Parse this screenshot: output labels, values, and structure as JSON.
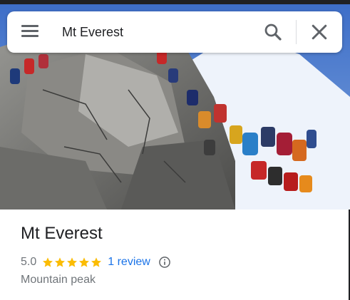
{
  "search": {
    "value": "Mt Everest",
    "placeholder": ""
  },
  "icons": {
    "menu": "menu-icon",
    "search": "search-icon",
    "close": "close-icon",
    "star": "star-icon",
    "info": "info-icon"
  },
  "place": {
    "name": "Mt Everest",
    "rating": "5.0",
    "stars": 5,
    "reviews_label": "1 review",
    "category": "Mountain peak"
  },
  "colors": {
    "star": "#fbbc04",
    "link": "#1a73e8",
    "secondary_text": "#70757a"
  }
}
